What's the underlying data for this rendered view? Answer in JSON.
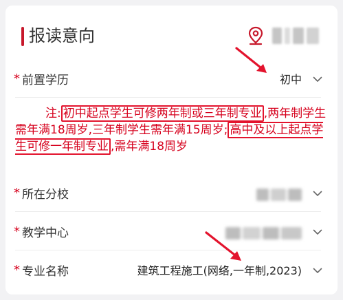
{
  "header": {
    "title": "报读意向",
    "location_icon": "location-pin-icon",
    "location_text": ""
  },
  "form": {
    "education": {
      "required": "*",
      "label": "前置学历",
      "value": "初中"
    },
    "note": {
      "prefix": "注:",
      "highlight1": "初中起点学生可修两年制或三年制专业",
      "part2": ",两年制学生需年满18周岁,三年制学生需年满15周岁;",
      "highlight2": "高中及以上起点学生可修一年制专业",
      "part3": ",需年满18周岁"
    },
    "branch": {
      "required": "*",
      "label": "所在分校",
      "value": ""
    },
    "center": {
      "required": "*",
      "label": "教学中心",
      "value": ""
    },
    "major": {
      "required": "*",
      "label": "专业名称",
      "value": "建筑工程施工(网络,一年制,2023)"
    }
  },
  "colors": {
    "accent": "#c7182b",
    "required": "#d6001c",
    "note": "#d6001c"
  }
}
